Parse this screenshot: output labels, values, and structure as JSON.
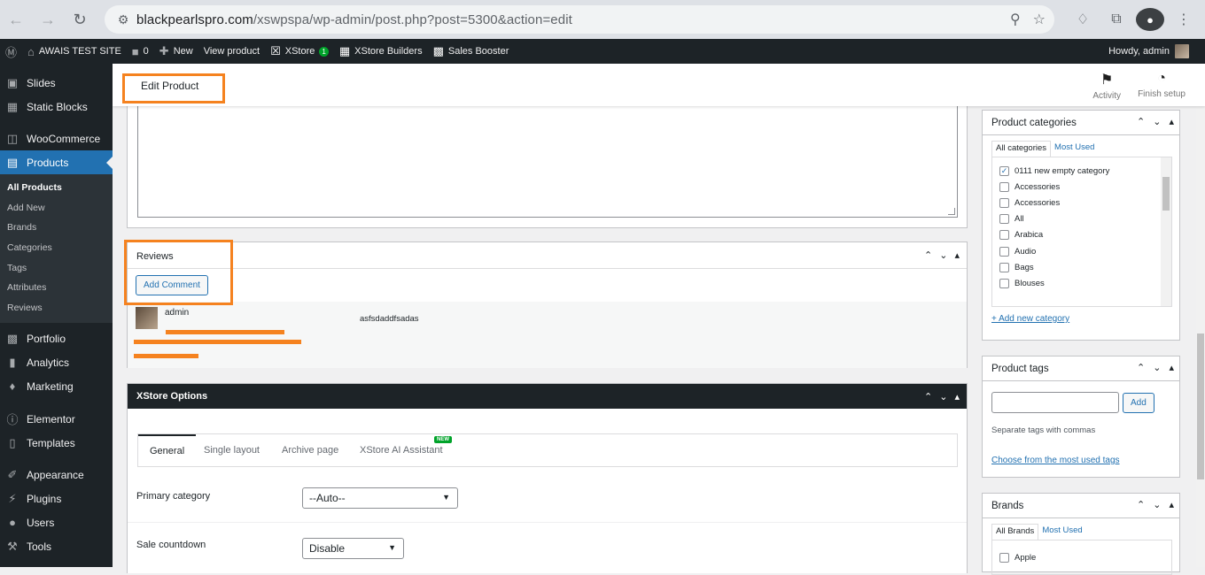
{
  "browser": {
    "url_host": "blackpearlspro.com",
    "url_path": "/xswpspa/wp-admin/post.php?post=5300&action=edit"
  },
  "adminbar": {
    "site_name": "AWAIS TEST SITE",
    "comments_count": "0",
    "new_label": "New",
    "view_product": "View product",
    "xstore_label": "XStore",
    "xstore_badge": "1",
    "xstore_builders": "XStore Builders",
    "sales_booster": "Sales Booster",
    "howdy": "Howdy, admin"
  },
  "sidebar": {
    "slides": "Slides",
    "static_blocks": "Static Blocks",
    "woocommerce": "WooCommerce",
    "products": "Products",
    "submenu": [
      "All Products",
      "Add New",
      "Brands",
      "Categories",
      "Tags",
      "Attributes",
      "Reviews"
    ],
    "portfolio": "Portfolio",
    "analytics": "Analytics",
    "marketing": "Marketing",
    "elementor": "Elementor",
    "templates": "Templates",
    "appearance": "Appearance",
    "plugins": "Plugins",
    "users": "Users",
    "tools": "Tools"
  },
  "topbar": {
    "title": "Edit Product",
    "activity": "Activity",
    "finish_setup": "Finish setup"
  },
  "reviews": {
    "title": "Reviews",
    "add_comment": "Add Comment",
    "author": "admin",
    "comment_text": "asfsdaddfsadas"
  },
  "xstore_options": {
    "title": "XStore Options",
    "tabs": [
      "General",
      "Single layout",
      "Archive page",
      "XStore AI Assistant"
    ],
    "new_badge": "NEW",
    "primary_category_label": "Primary category",
    "primary_category_value": "--Auto--",
    "sale_countdown_label": "Sale countdown",
    "sale_countdown_value": "Disable"
  },
  "product_categories": {
    "title": "Product categories",
    "tab_all": "All categories",
    "tab_most_used": "Most Used",
    "items": [
      {
        "label": "0111 new empty category",
        "checked": true
      },
      {
        "label": "Accessories",
        "checked": false
      },
      {
        "label": "Accessories",
        "checked": false
      },
      {
        "label": "All",
        "checked": false
      },
      {
        "label": "Arabica",
        "checked": false
      },
      {
        "label": "Audio",
        "checked": false
      },
      {
        "label": "Bags",
        "checked": false
      },
      {
        "label": "Blouses",
        "checked": false
      }
    ],
    "add_new": "+ Add new category"
  },
  "product_tags": {
    "title": "Product tags",
    "add_button": "Add",
    "hint": "Separate tags with commas",
    "choose_link": "Choose from the most used tags"
  },
  "brands": {
    "title": "Brands",
    "tab_all": "All Brands",
    "tab_most_used": "Most Used",
    "first_item": "Apple"
  },
  "colors": {
    "highlight": "#f5821f",
    "accent": "#2271b1",
    "admin_dark": "#1d2327"
  }
}
